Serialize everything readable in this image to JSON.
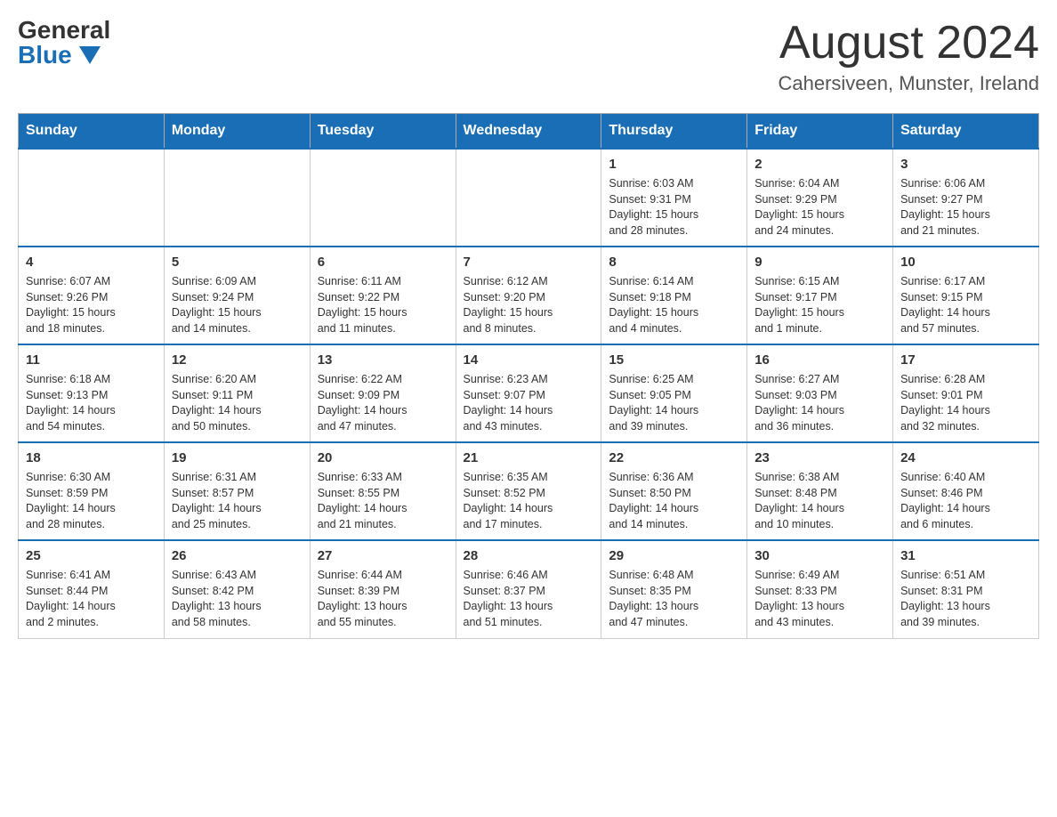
{
  "header": {
    "logo_general": "General",
    "logo_blue": "Blue",
    "month_title": "August 2024",
    "location": "Cahersiveen, Munster, Ireland"
  },
  "weekdays": [
    "Sunday",
    "Monday",
    "Tuesday",
    "Wednesday",
    "Thursday",
    "Friday",
    "Saturday"
  ],
  "weeks": [
    [
      {
        "day": "",
        "info": ""
      },
      {
        "day": "",
        "info": ""
      },
      {
        "day": "",
        "info": ""
      },
      {
        "day": "",
        "info": ""
      },
      {
        "day": "1",
        "info": "Sunrise: 6:03 AM\nSunset: 9:31 PM\nDaylight: 15 hours\nand 28 minutes."
      },
      {
        "day": "2",
        "info": "Sunrise: 6:04 AM\nSunset: 9:29 PM\nDaylight: 15 hours\nand 24 minutes."
      },
      {
        "day": "3",
        "info": "Sunrise: 6:06 AM\nSunset: 9:27 PM\nDaylight: 15 hours\nand 21 minutes."
      }
    ],
    [
      {
        "day": "4",
        "info": "Sunrise: 6:07 AM\nSunset: 9:26 PM\nDaylight: 15 hours\nand 18 minutes."
      },
      {
        "day": "5",
        "info": "Sunrise: 6:09 AM\nSunset: 9:24 PM\nDaylight: 15 hours\nand 14 minutes."
      },
      {
        "day": "6",
        "info": "Sunrise: 6:11 AM\nSunset: 9:22 PM\nDaylight: 15 hours\nand 11 minutes."
      },
      {
        "day": "7",
        "info": "Sunrise: 6:12 AM\nSunset: 9:20 PM\nDaylight: 15 hours\nand 8 minutes."
      },
      {
        "day": "8",
        "info": "Sunrise: 6:14 AM\nSunset: 9:18 PM\nDaylight: 15 hours\nand 4 minutes."
      },
      {
        "day": "9",
        "info": "Sunrise: 6:15 AM\nSunset: 9:17 PM\nDaylight: 15 hours\nand 1 minute."
      },
      {
        "day": "10",
        "info": "Sunrise: 6:17 AM\nSunset: 9:15 PM\nDaylight: 14 hours\nand 57 minutes."
      }
    ],
    [
      {
        "day": "11",
        "info": "Sunrise: 6:18 AM\nSunset: 9:13 PM\nDaylight: 14 hours\nand 54 minutes."
      },
      {
        "day": "12",
        "info": "Sunrise: 6:20 AM\nSunset: 9:11 PM\nDaylight: 14 hours\nand 50 minutes."
      },
      {
        "day": "13",
        "info": "Sunrise: 6:22 AM\nSunset: 9:09 PM\nDaylight: 14 hours\nand 47 minutes."
      },
      {
        "day": "14",
        "info": "Sunrise: 6:23 AM\nSunset: 9:07 PM\nDaylight: 14 hours\nand 43 minutes."
      },
      {
        "day": "15",
        "info": "Sunrise: 6:25 AM\nSunset: 9:05 PM\nDaylight: 14 hours\nand 39 minutes."
      },
      {
        "day": "16",
        "info": "Sunrise: 6:27 AM\nSunset: 9:03 PM\nDaylight: 14 hours\nand 36 minutes."
      },
      {
        "day": "17",
        "info": "Sunrise: 6:28 AM\nSunset: 9:01 PM\nDaylight: 14 hours\nand 32 minutes."
      }
    ],
    [
      {
        "day": "18",
        "info": "Sunrise: 6:30 AM\nSunset: 8:59 PM\nDaylight: 14 hours\nand 28 minutes."
      },
      {
        "day": "19",
        "info": "Sunrise: 6:31 AM\nSunset: 8:57 PM\nDaylight: 14 hours\nand 25 minutes."
      },
      {
        "day": "20",
        "info": "Sunrise: 6:33 AM\nSunset: 8:55 PM\nDaylight: 14 hours\nand 21 minutes."
      },
      {
        "day": "21",
        "info": "Sunrise: 6:35 AM\nSunset: 8:52 PM\nDaylight: 14 hours\nand 17 minutes."
      },
      {
        "day": "22",
        "info": "Sunrise: 6:36 AM\nSunset: 8:50 PM\nDaylight: 14 hours\nand 14 minutes."
      },
      {
        "day": "23",
        "info": "Sunrise: 6:38 AM\nSunset: 8:48 PM\nDaylight: 14 hours\nand 10 minutes."
      },
      {
        "day": "24",
        "info": "Sunrise: 6:40 AM\nSunset: 8:46 PM\nDaylight: 14 hours\nand 6 minutes."
      }
    ],
    [
      {
        "day": "25",
        "info": "Sunrise: 6:41 AM\nSunset: 8:44 PM\nDaylight: 14 hours\nand 2 minutes."
      },
      {
        "day": "26",
        "info": "Sunrise: 6:43 AM\nSunset: 8:42 PM\nDaylight: 13 hours\nand 58 minutes."
      },
      {
        "day": "27",
        "info": "Sunrise: 6:44 AM\nSunset: 8:39 PM\nDaylight: 13 hours\nand 55 minutes."
      },
      {
        "day": "28",
        "info": "Sunrise: 6:46 AM\nSunset: 8:37 PM\nDaylight: 13 hours\nand 51 minutes."
      },
      {
        "day": "29",
        "info": "Sunrise: 6:48 AM\nSunset: 8:35 PM\nDaylight: 13 hours\nand 47 minutes."
      },
      {
        "day": "30",
        "info": "Sunrise: 6:49 AM\nSunset: 8:33 PM\nDaylight: 13 hours\nand 43 minutes."
      },
      {
        "day": "31",
        "info": "Sunrise: 6:51 AM\nSunset: 8:31 PM\nDaylight: 13 hours\nand 39 minutes."
      }
    ]
  ]
}
